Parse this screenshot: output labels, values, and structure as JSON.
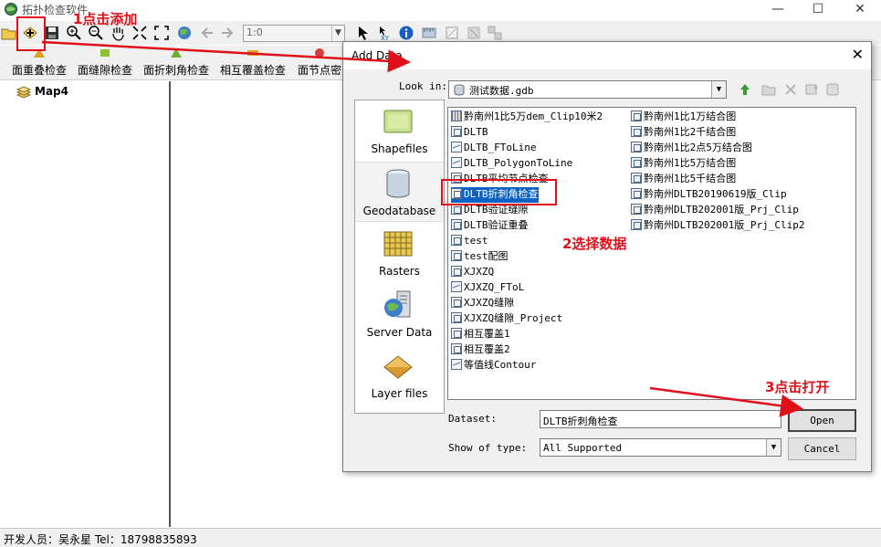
{
  "window": {
    "title": "拓扑检查软件",
    "minimize": "—",
    "maximize": "☐",
    "close": "✕"
  },
  "toolbar": {
    "scale_value": "1:0"
  },
  "check_buttons": [
    {
      "label": "面重叠检查",
      "color": "#e0a020"
    },
    {
      "label": "面缝隙检查",
      "color": "#8cc030"
    },
    {
      "label": "面折刺角检查",
      "color": "#70b030"
    },
    {
      "label": "相互覆盖检查",
      "color": "#e0a020"
    },
    {
      "label": "面节点密",
      "color": "#d04040"
    }
  ],
  "toc": {
    "map_name": "Map4"
  },
  "statusbar": {
    "text": "开发人员：吴永星 Tel：18798835893"
  },
  "dialog": {
    "title": "Add Data",
    "close": "✕",
    "lookin_label": "Look in:",
    "lookin_value": "测试数据.gdb",
    "catalog": [
      "Shapefiles",
      "Geodatabase",
      "Rasters",
      "Server Data",
      "Layer files"
    ],
    "files_col1": [
      {
        "name": "黔南州1比5万dem_Clip10米2",
        "kind": "raster"
      },
      {
        "name": "DLTB",
        "kind": "poly"
      },
      {
        "name": "DLTB_FToLine",
        "kind": "line"
      },
      {
        "name": "DLTB_PolygonToLine",
        "kind": "line"
      },
      {
        "name": "DLTB平均节点检查",
        "kind": "poly"
      },
      {
        "name": "DLTB折刺角检查",
        "kind": "poly"
      },
      {
        "name": "DLTB验证缝隙",
        "kind": "poly"
      },
      {
        "name": "DLTB验证重叠",
        "kind": "poly"
      },
      {
        "name": "test",
        "kind": "poly"
      },
      {
        "name": "test配图",
        "kind": "poly"
      },
      {
        "name": "XJXZQ",
        "kind": "poly"
      },
      {
        "name": "XJXZQ_FToL",
        "kind": "line"
      },
      {
        "name": "XJXZQ缝隙",
        "kind": "poly"
      },
      {
        "name": "XJXZQ缝隙_Project",
        "kind": "poly"
      },
      {
        "name": "相互覆盖1",
        "kind": "poly"
      },
      {
        "name": "相互覆盖2",
        "kind": "poly"
      },
      {
        "name": "等值线Contour",
        "kind": "line"
      }
    ],
    "files_col2": [
      {
        "name": "黔南州1比1万结合图",
        "kind": "poly"
      },
      {
        "name": "黔南州1比2千结合图",
        "kind": "poly"
      },
      {
        "name": "黔南州1比2点5万结合图",
        "kind": "poly"
      },
      {
        "name": "黔南州1比5万结合图",
        "kind": "poly"
      },
      {
        "name": "黔南州1比5千结合图",
        "kind": "poly"
      },
      {
        "name": "黔南州DLTB20190619版_Clip",
        "kind": "poly"
      },
      {
        "name": "黔南州DLTB202001版_Prj_Clip",
        "kind": "poly"
      },
      {
        "name": "黔南州DLTB202001版_Prj_Clip2",
        "kind": "poly"
      }
    ],
    "selected_index": 5,
    "dataset_label": "Dataset:",
    "dataset_value": "DLTB折刺角检查",
    "type_label": "Show of type:",
    "type_value": "All Supported",
    "open_label": "Open",
    "cancel_label": "Cancel"
  },
  "annotations": {
    "step1": "1点击添加",
    "step2": "2选择数据",
    "step3": "3点击打开"
  },
  "colors": {
    "annotation_red": "#e0101a",
    "selection_blue": "#0b62c4"
  }
}
